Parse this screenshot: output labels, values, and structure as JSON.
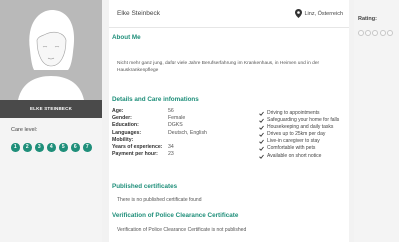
{
  "profile": {
    "name": "Elke Steinbeck",
    "name_caps": "ELKE STEINBECK",
    "location": "Linz, Österreich"
  },
  "care": {
    "label": "Care level:",
    "levels": [
      "1",
      "2",
      "3",
      "4",
      "5",
      "6",
      "7"
    ]
  },
  "sections": {
    "about_title": "About Me",
    "about_text": "Nicht mehr ganz jung, dafür viele Jahre Berufserfahrung im Krankenhaus, in Heimen und in der Hauskrankenpflege",
    "details_title": "Details and Care infomations",
    "certs_title": "Published certificates",
    "certs_empty": "There is no published certificate found",
    "police_title": "Verification of Police Clearance Certificate",
    "police_empty": "Verification of Police Clearance Certificate is not published"
  },
  "details": [
    {
      "label": "Age:",
      "value": "56"
    },
    {
      "label": "Gender:",
      "value": "Female"
    },
    {
      "label": "Education:",
      "value": "DGKS"
    },
    {
      "label": "Languages:",
      "value": "Deutsch, English"
    },
    {
      "label": "Mobility:",
      "value": ""
    },
    {
      "label": "Years of experience:",
      "value": "34"
    },
    {
      "label": "Payment per hour:",
      "value": "23"
    }
  ],
  "features": [
    "Driving to appointments",
    "Safeguarding your home for falls",
    "Housekeeping and daily tasks",
    "Drives up to 25km per day",
    "Live-in caregiver to stay",
    "Comfortable with pets",
    "Available on short notice"
  ],
  "rating": {
    "label": "Rating:",
    "filled": 0,
    "max": 5
  },
  "colors": {
    "accent": "#1f8f7a",
    "name_plate": "#4a4a4a",
    "avatar_bg": "#b9b9b9"
  },
  "icons": {
    "location": "map-pin-icon",
    "feature": "check-icon"
  }
}
